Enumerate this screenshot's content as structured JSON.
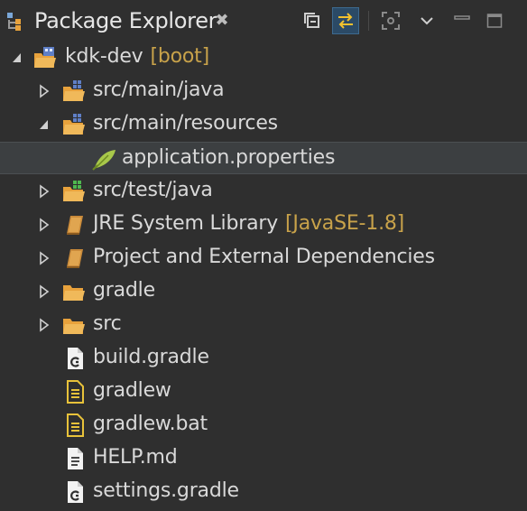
{
  "view": {
    "title": "Package Explorer",
    "close_glyph": "✖"
  },
  "toolbar": {
    "icons": [
      "collapse-all-icon",
      "link-with-editor-icon",
      "focus-icon",
      "view-menu-icon",
      "minimize-icon",
      "maximize-icon"
    ],
    "active": "link-with-editor-icon"
  },
  "tree": {
    "project": {
      "label": "kdk-dev",
      "decoration": "[boot]"
    },
    "items": [
      {
        "label": "src/main/java",
        "icon": "source-folder-icon"
      },
      {
        "label": "src/main/resources",
        "icon": "source-folder-icon"
      },
      {
        "label": "application.properties",
        "icon": "properties-file-icon"
      },
      {
        "label": "src/test/java",
        "icon": "test-source-folder-icon"
      },
      {
        "label": "JRE System Library",
        "decoration": "[JavaSE-1.8]",
        "icon": "library-icon"
      },
      {
        "label": "Project and External Dependencies",
        "icon": "library-icon"
      },
      {
        "label": "gradle",
        "icon": "folder-icon"
      },
      {
        "label": "src",
        "icon": "folder-icon"
      },
      {
        "label": "build.gradle",
        "icon": "gradle-file-icon"
      },
      {
        "label": "gradlew",
        "icon": "text-file-icon"
      },
      {
        "label": "gradlew.bat",
        "icon": "text-file-icon"
      },
      {
        "label": "HELP.md",
        "icon": "file-icon"
      },
      {
        "label": "settings.gradle",
        "icon": "gradle-file-icon"
      }
    ]
  },
  "colors": {
    "background": "#2f2f2f",
    "selection": "#3c3f41",
    "decoration": "#c8a24a",
    "folder": "#e8a23c"
  }
}
